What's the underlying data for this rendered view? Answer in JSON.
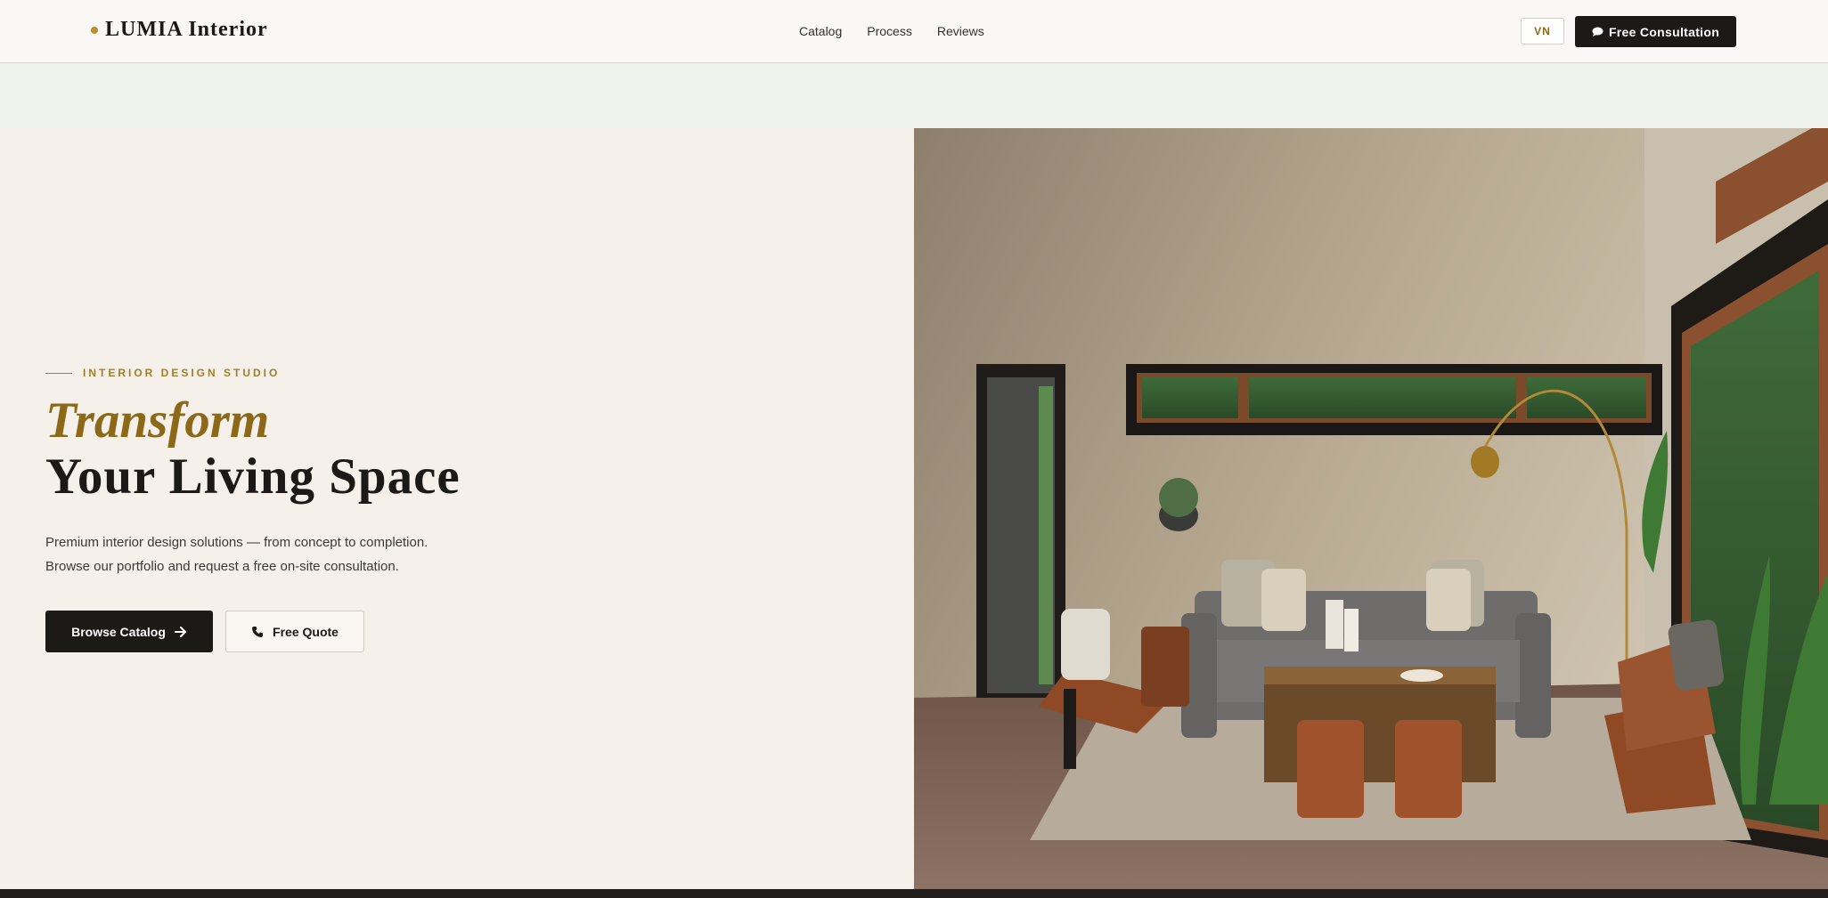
{
  "header": {
    "logo_text": "LUMIA Interior",
    "nav": [
      "Catalog",
      "Process",
      "Reviews"
    ],
    "lang_label": "VN",
    "cta_label": "Free Consultation"
  },
  "hero": {
    "eyebrow": "INTERIOR DESIGN STUDIO",
    "title_accent": "Transform",
    "title_main": "Your Living Space",
    "description_line1": "Premium interior design solutions — from concept to completion.",
    "description_line2": "Browse our portfolio and request a free on-site consultation.",
    "primary_button": "Browse Catalog",
    "secondary_button": "Free Quote"
  },
  "colors": {
    "accent_gold": "#8c6918",
    "dark": "#1c1a17",
    "background": "#f5f0ea"
  },
  "icons": {
    "consultation": "chat-bubble-icon",
    "browse": "arrow-right-icon",
    "quote": "phone-icon"
  }
}
